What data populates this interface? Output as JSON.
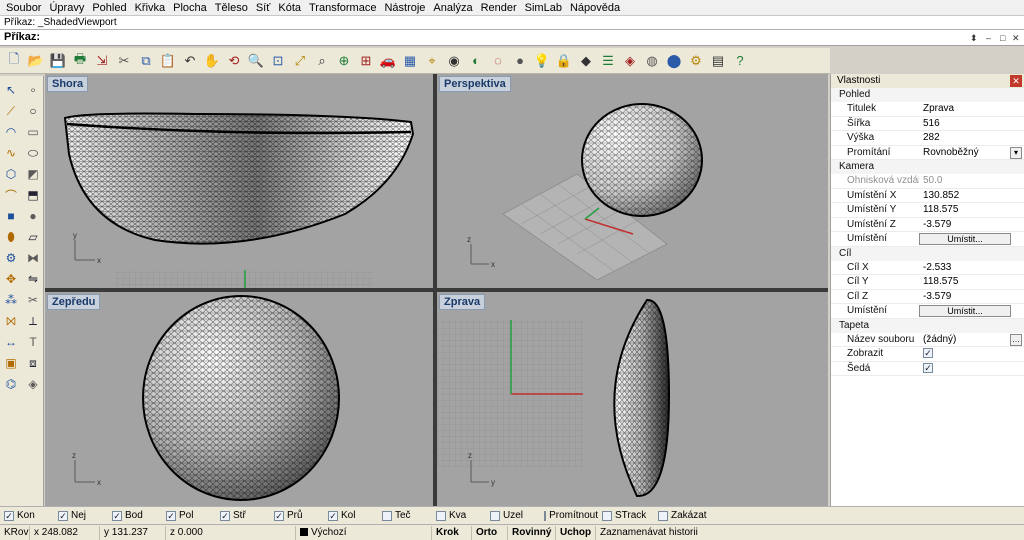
{
  "menu": [
    "Soubor",
    "Úpravy",
    "Pohled",
    "Křivka",
    "Plocha",
    "Těleso",
    "Síť",
    "Kóta",
    "Transformace",
    "Nástroje",
    "Analýza",
    "Render",
    "SimLab",
    "Nápověda"
  ],
  "command": {
    "history": "Příkaz: _ShadedViewport",
    "prompt": "Příkaz:"
  },
  "viewports": {
    "top": {
      "title": "Shora"
    },
    "perspective": {
      "title": "Perspektiva"
    },
    "front": {
      "title": "Zepředu"
    },
    "right": {
      "title": "Zprava"
    }
  },
  "axis_labels": {
    "x": "x",
    "y": "y",
    "z": "z"
  },
  "properties": {
    "header": "Vlastnosti",
    "section_view": "Pohled",
    "rows_view": [
      {
        "key": "Titulek",
        "value": "Zprava"
      },
      {
        "key": "Šířka",
        "value": "516"
      },
      {
        "key": "Výška",
        "value": "282"
      },
      {
        "key": "Promítání",
        "value": "Rovnoběžný"
      }
    ],
    "group_camera": "Kamera",
    "rows_camera": [
      {
        "key": "Ohnisková vzdálenost",
        "value": "50.0"
      },
      {
        "key": "Umístění X",
        "value": "130.852"
      },
      {
        "key": "Umístění Y",
        "value": "118.575"
      },
      {
        "key": "Umístění Z",
        "value": "-3.579"
      },
      {
        "key": "Umístění",
        "button": "Umístit..."
      }
    ],
    "group_target": "Cíl",
    "rows_target": [
      {
        "key": "Cíl X",
        "value": "-2.533"
      },
      {
        "key": "Cíl Y",
        "value": "118.575"
      },
      {
        "key": "Cíl Z",
        "value": "-3.579"
      },
      {
        "key": "Umístění",
        "button": "Umístit..."
      }
    ],
    "group_wallpaper": "Tapeta",
    "rows_wallpaper": [
      {
        "key": "Název souboru",
        "value": "(žádný)"
      },
      {
        "key": "Zobrazit",
        "checked": true
      },
      {
        "key": "Šedá",
        "checked": true
      }
    ]
  },
  "osnaps": [
    {
      "label": "Kon",
      "checked": true
    },
    {
      "label": "Nej",
      "checked": true
    },
    {
      "label": "Bod",
      "checked": true
    },
    {
      "label": "Pol",
      "checked": true
    },
    {
      "label": "Stř",
      "checked": true
    },
    {
      "label": "Prů",
      "checked": true
    },
    {
      "label": "Kol",
      "checked": true
    },
    {
      "label": "Teč",
      "checked": false
    },
    {
      "label": "Kva",
      "checked": false
    },
    {
      "label": "Uzel",
      "checked": false
    },
    {
      "label": "Promítnout",
      "checked": false
    },
    {
      "label": "STrack",
      "checked": false
    },
    {
      "label": "Zakázat",
      "checked": false
    }
  ],
  "status": {
    "cplane": "KRov",
    "x": "x 248.082",
    "y": "y 131.237",
    "z": "z 0.000",
    "layer": "Výchozí",
    "grid_snap": "Krok",
    "ortho": "Orto",
    "planar": "Rovinný",
    "osnap": "Uchop",
    "history": "Zaznamenávat historii"
  },
  "colors": {
    "viewport_bg": "#a3a3a3",
    "axis_x": "#c03030",
    "axis_y": "#20a040",
    "mesh": "#000000"
  },
  "toolbar_icons": [
    "new-icon",
    "open-icon",
    "save-icon",
    "print-icon",
    "import-icon",
    "cut-icon",
    "copy-icon",
    "paste-icon",
    "undo-icon",
    "pan-icon",
    "rotate-view-icon",
    "zoom-icon",
    "zoom-window-icon",
    "zoom-extents-icon",
    "zoom-selected-icon",
    "zoom-target-icon",
    "viewport-layout-icon",
    "car-icon",
    "grid-plane-icon",
    "snap-icon",
    "rendered-icon",
    "shaded-icon",
    "ghosted-icon",
    "render-icon",
    "light-icon",
    "lock-icon",
    "material-icon",
    "layer-icon",
    "color-icon",
    "xray-icon",
    "shaded-sphere-icon",
    "options-icon",
    "toolbar-icon",
    "help-icon"
  ],
  "left_tool_icons": [
    "select-icon",
    "point-icon",
    "polyline-icon",
    "circle-icon",
    "arc-icon",
    "rectangle-icon",
    "curve-icon",
    "ellipse-icon",
    "polygon-icon",
    "surface-icon",
    "fillet-icon",
    "extrude-icon",
    "box-icon",
    "sphere-icon",
    "cylinder-icon",
    "plane-surface-icon",
    "mesh-icon",
    "boolean-icon",
    "transform-icon",
    "mirror-icon",
    "array-icon",
    "trim-icon",
    "join-icon",
    "split-icon",
    "dimension-icon",
    "text-icon",
    "block-icon",
    "group-icon",
    "analyze-icon",
    "render-tool-icon"
  ]
}
